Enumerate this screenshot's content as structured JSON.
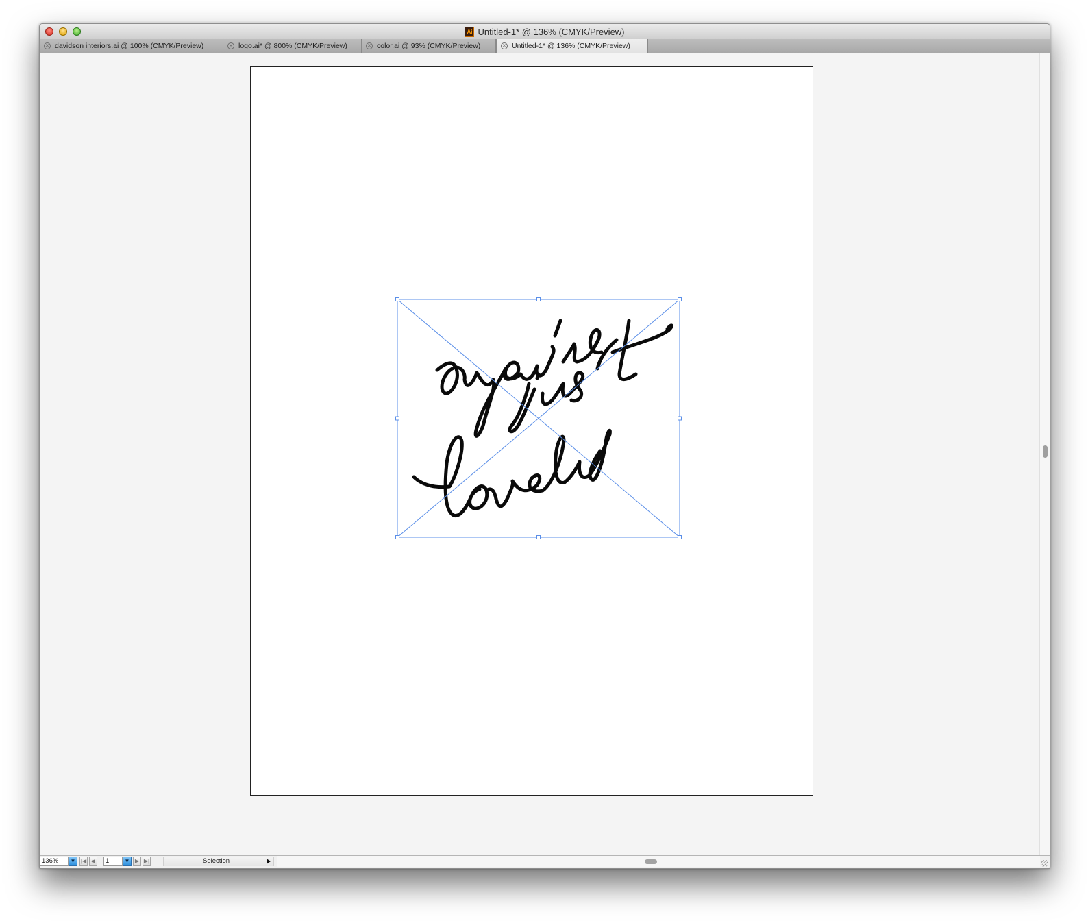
{
  "window": {
    "title": "Untitled-1* @ 136% (CMYK/Preview)",
    "app_icon": "illustrator-ai-icon",
    "app_icon_text": "Ai"
  },
  "tabs": [
    {
      "label": "davidson interiors.ai @ 100% (CMYK/Preview)",
      "active": false
    },
    {
      "label": "logo.ai* @ 800% (CMYK/Preview)",
      "active": false
    },
    {
      "label": "color.ai @ 93% (CMYK/Preview)",
      "active": false
    },
    {
      "label": "Untitled-1* @ 136% (CMYK/Preview)",
      "active": true
    }
  ],
  "canvas": {
    "placed_image": {
      "lines": [
        "you're",
        "just",
        "lovely"
      ],
      "selection_color": "#5b8fe8",
      "ink_color": "#0a0a0a"
    }
  },
  "statusbar": {
    "zoom": "136%",
    "page": "1",
    "tool": "Selection"
  },
  "colors": {
    "accent_blue": "#2d8fdd",
    "workspace": "#f4f4f4"
  }
}
